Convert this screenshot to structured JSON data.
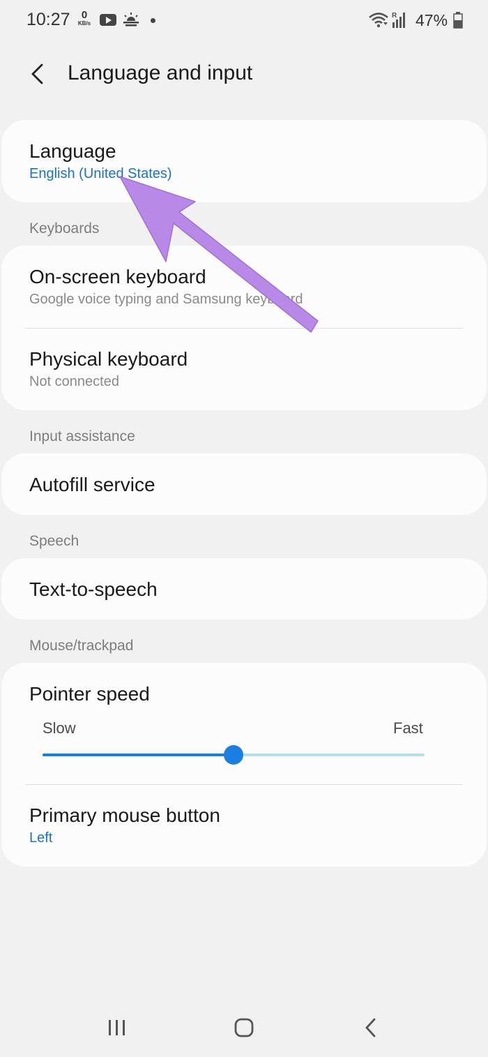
{
  "status_bar": {
    "time": "10:27",
    "net_speed_value": "0",
    "net_speed_unit": "KB/s",
    "roaming_indicator": "R",
    "battery_percent": "47%",
    "icons": [
      "youtube-icon",
      "weather-sunrise-icon",
      "notification-dot",
      "wifi-icon",
      "signal-icon",
      "battery-icon"
    ]
  },
  "header": {
    "title": "Language and input"
  },
  "language": {
    "title": "Language",
    "value": "English (United States)"
  },
  "keyboards": {
    "section_label": "Keyboards",
    "onscreen_title": "On-screen keyboard",
    "onscreen_sub": "Google voice typing and Samsung keyboard",
    "physical_title": "Physical keyboard",
    "physical_sub": "Not connected"
  },
  "input_assistance": {
    "section_label": "Input assistance",
    "autofill_title": "Autofill service"
  },
  "speech": {
    "section_label": "Speech",
    "tts_title": "Text-to-speech"
  },
  "mouse": {
    "section_label": "Mouse/trackpad",
    "pointer_title": "Pointer speed",
    "slow_label": "Slow",
    "fast_label": "Fast",
    "pointer_speed_fraction": 0.5,
    "primary_title": "Primary mouse button",
    "primary_value": "Left"
  },
  "colors": {
    "accent_blue": "#1a73c8",
    "slider_active": "#1a7fe0",
    "slider_inactive": "#b9dcf5",
    "annotation_arrow": "#b889e6",
    "background": "#f1f1f1",
    "card": "#fcfcfc"
  }
}
